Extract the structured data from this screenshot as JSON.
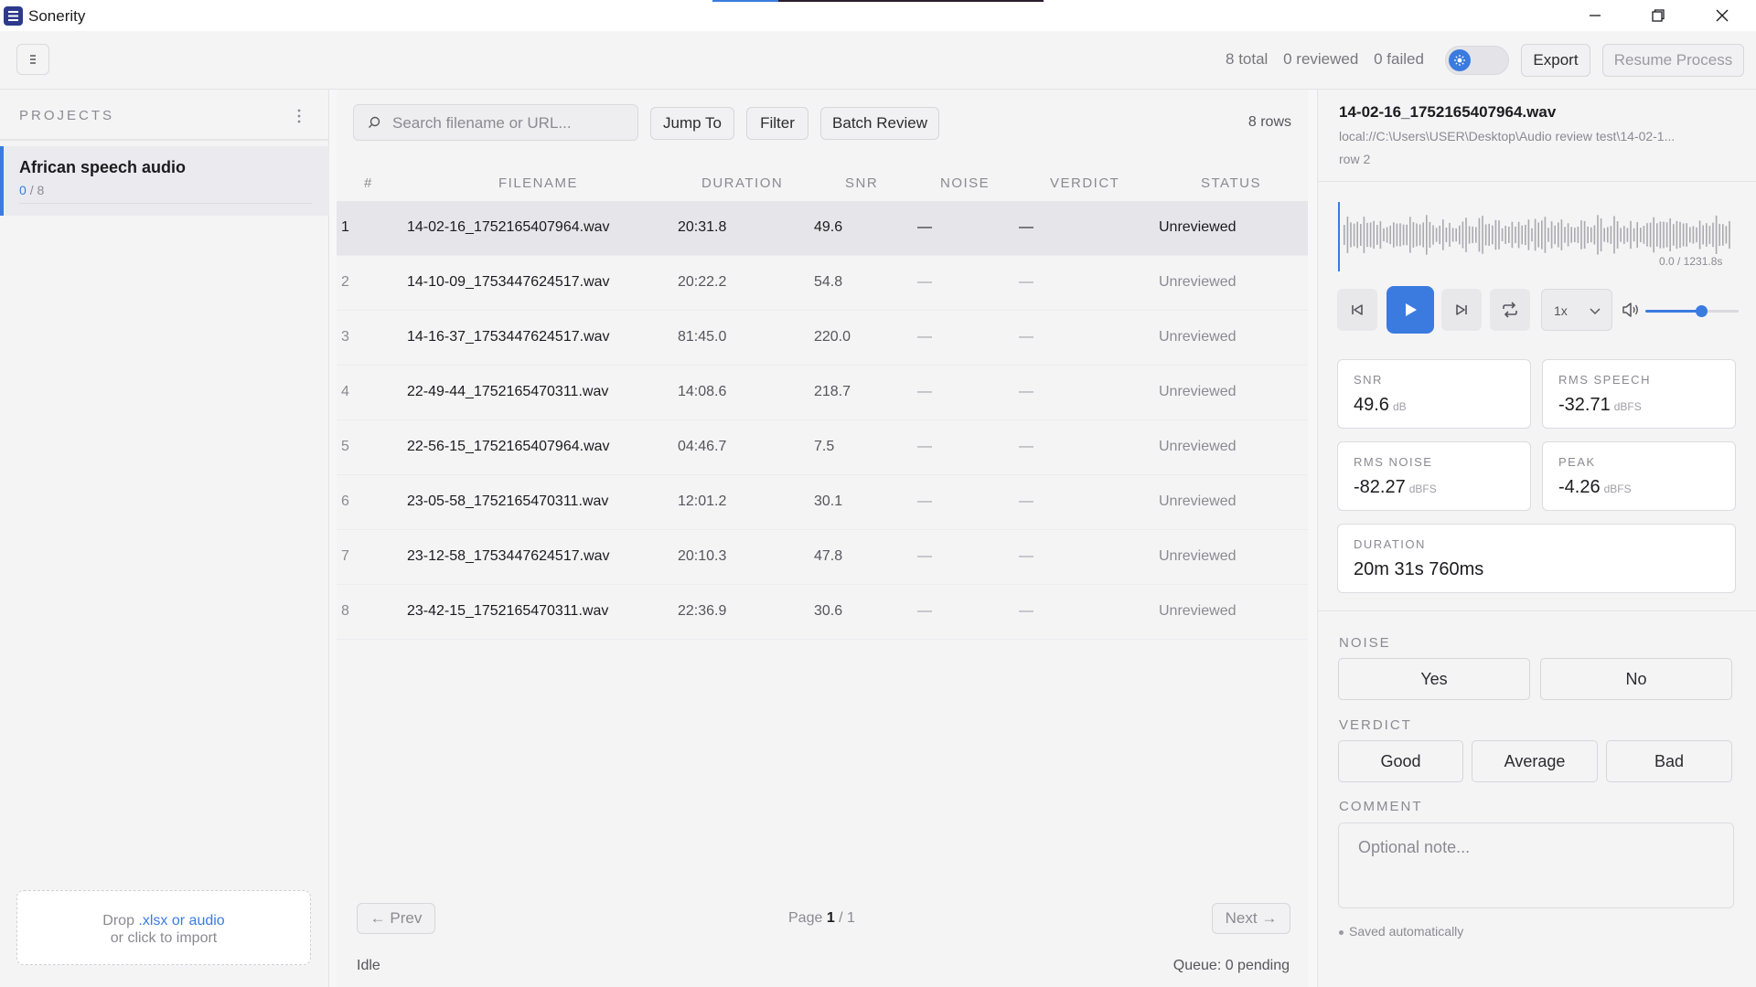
{
  "app": {
    "title": "Sonerity",
    "top_progress": 0.2,
    "accent": "#3b7be0"
  },
  "toolbar": {
    "stats": {
      "total": "8",
      "total_label": "total",
      "reviewed": "0",
      "reviewed_label": "reviewed",
      "failed": "0",
      "failed_label": "failed"
    },
    "theme_toggle_icon": "sun-icon",
    "export_label": "Export",
    "resume_label": "Resume Process"
  },
  "sidebar": {
    "header": "PROJECTS",
    "projects": [
      {
        "name": "African speech audio",
        "reviewed": "0",
        "total": "/ 8"
      }
    ],
    "dropzone": {
      "prefix": "Drop ",
      "link": ".xlsx or audio",
      "line2": "or click to import"
    }
  },
  "center": {
    "search_placeholder": "Search filename or URL...",
    "jump_label": "Jump To",
    "filter_label": "Filter",
    "batch_label": "Batch Review",
    "row_count": "8 rows",
    "columns": [
      "#",
      "FILENAME",
      "DURATION",
      "SNR",
      "NOISE",
      "VERDICT",
      "STATUS"
    ],
    "rows": [
      {
        "num": "1",
        "file": "14-02-16_1752165407964.wav",
        "duration": "20:31.8",
        "snr": "49.6",
        "noise": "—",
        "verdict": "—",
        "status": "Unreviewed"
      },
      {
        "num": "2",
        "file": "14-10-09_1753447624517.wav",
        "duration": "20:22.2",
        "snr": "54.8",
        "noise": "—",
        "verdict": "—",
        "status": "Unreviewed"
      },
      {
        "num": "3",
        "file": "14-16-37_1753447624517.wav",
        "duration": "81:45.0",
        "snr": "220.0",
        "noise": "—",
        "verdict": "—",
        "status": "Unreviewed"
      },
      {
        "num": "4",
        "file": "22-49-44_1752165470311.wav",
        "duration": "14:08.6",
        "snr": "218.7",
        "noise": "—",
        "verdict": "—",
        "status": "Unreviewed"
      },
      {
        "num": "5",
        "file": "22-56-15_1752165407964.wav",
        "duration": "04:46.7",
        "snr": "7.5",
        "noise": "—",
        "verdict": "—",
        "status": "Unreviewed"
      },
      {
        "num": "6",
        "file": "23-05-58_1752165470311.wav",
        "duration": "12:01.2",
        "snr": "30.1",
        "noise": "—",
        "verdict": "—",
        "status": "Unreviewed"
      },
      {
        "num": "7",
        "file": "23-12-58_1753447624517.wav",
        "duration": "20:10.3",
        "snr": "47.8",
        "noise": "—",
        "verdict": "—",
        "status": "Unreviewed"
      },
      {
        "num": "8",
        "file": "23-42-15_1752165470311.wav",
        "duration": "22:36.9",
        "snr": "30.6",
        "noise": "—",
        "verdict": "—",
        "status": "Unreviewed"
      }
    ],
    "prev_label": "← Prev",
    "next_label": "Next →",
    "page_prefix": "Page ",
    "page_current": "1",
    "page_total": " / 1",
    "footer_status": "Idle",
    "footer_queue": "Queue: 0 pending"
  },
  "detail": {
    "filename": "14-02-16_1752165407964.wav",
    "path": "local://C:\\Users\\USER\\Desktop\\Audio review test\\14-02-1...",
    "row_label": "row 2",
    "time_readout": "0.0 / 1231.8s",
    "speed": "1x",
    "volume": 0.6,
    "metrics": {
      "snr": {
        "label": "SNR",
        "value": "49.6",
        "unit": "dB"
      },
      "rms_speech": {
        "label": "RMS SPEECH",
        "value": "-32.71",
        "unit": "dBFS"
      },
      "rms_noise": {
        "label": "RMS NOISE",
        "value": "-82.27",
        "unit": "dBFS"
      },
      "peak": {
        "label": "PEAK",
        "value": "-4.26",
        "unit": "dBFS"
      },
      "duration": {
        "label": "DURATION",
        "value": "20m 31s 760ms"
      }
    },
    "noise_label": "NOISE",
    "noise_options": [
      "Yes",
      "No"
    ],
    "verdict_label": "VERDICT",
    "verdict_options": [
      "Good",
      "Average",
      "Bad"
    ],
    "comment_label": "COMMENT",
    "comment_placeholder": "Optional note...",
    "saved_text": "Saved automatically"
  }
}
